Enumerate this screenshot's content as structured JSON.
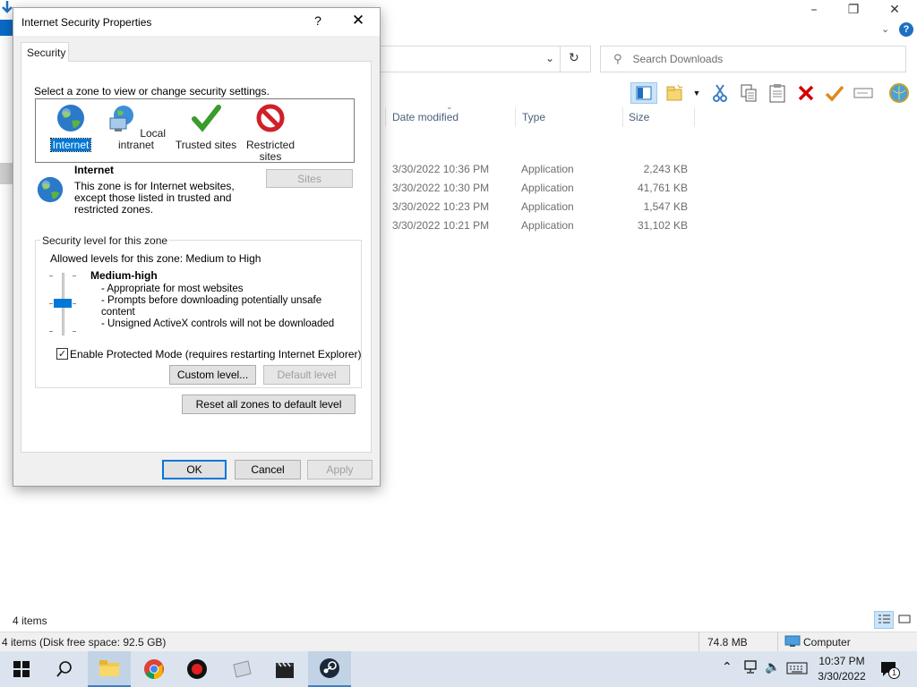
{
  "dialog": {
    "title": "Internet Security Properties",
    "help": "?",
    "tab": "Security",
    "zone_prompt": "Select a zone to view or change security settings.",
    "zones": [
      {
        "line1": "Internet",
        "line2": "",
        "icon": "globe-icon"
      },
      {
        "line1": "Local intranet",
        "line2": "",
        "icon": "intranet-icon"
      },
      {
        "line1": "Trusted sites",
        "line2": "",
        "icon": "checkmark-icon"
      },
      {
        "line1": "Restricted",
        "line2": "sites",
        "icon": "restricted-icon"
      }
    ],
    "selected_zone": {
      "name": "Internet",
      "description_1": "This zone is for Internet websites,",
      "description_2": "except those listed in trusted and",
      "description_3": "restricted zones."
    },
    "sites_button": "Sites",
    "security_level_group": "Security level for this zone",
    "allowed_levels": "Allowed levels for this zone: Medium to High",
    "level_name": "Medium-high",
    "level_bullets": [
      "- Appropriate for most websites",
      "- Prompts before downloading potentially unsafe",
      "content",
      "- Unsigned ActiveX controls will not be downloaded"
    ],
    "protected_mode_label": "Enable Protected Mode (requires restarting Internet Explorer)",
    "protected_mode_checked": true,
    "custom_level_button": "Custom level...",
    "default_level_button": "Default level",
    "reset_button": "Reset all zones to default level",
    "ok_button": "OK",
    "cancel_button": "Cancel",
    "apply_button": "Apply"
  },
  "explorer": {
    "search_placeholder": "Search Downloads",
    "columns": [
      "Date modified",
      "Type",
      "Size"
    ],
    "files": [
      {
        "date": "3/30/2022 10:36 PM",
        "type": "Application",
        "size": "2,243 KB"
      },
      {
        "date": "3/30/2022 10:30 PM",
        "type": "Application",
        "size": "41,761 KB"
      },
      {
        "date": "3/30/2022 10:23 PM",
        "type": "Application",
        "size": "1,547 KB"
      },
      {
        "date": "3/30/2022 10:21 PM",
        "type": "Application",
        "size": "31,102 KB"
      }
    ],
    "item_count": "4 items",
    "status_left": "4 items (Disk free space: 92.5 GB)",
    "status_size": "74.8 MB",
    "status_location": "Computer",
    "help_glyph": "?"
  },
  "taskbar": {
    "time": "10:37 PM",
    "date": "3/30/2022",
    "notification_count": "1"
  },
  "colors": {
    "accent": "#0078d7",
    "taskbar": "#dbe4ee"
  }
}
